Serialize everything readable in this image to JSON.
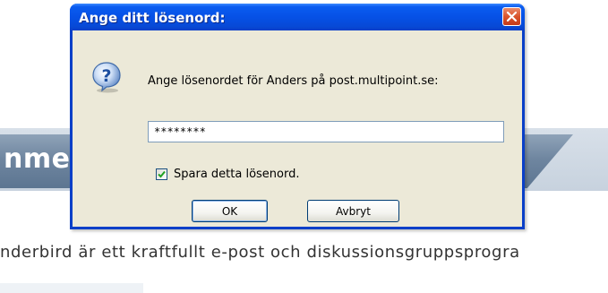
{
  "background": {
    "banner_heading": "nme",
    "paragraph": "nderbird är ett kraftfullt e-post och diskussionsgruppsprogra"
  },
  "dialog": {
    "title": "Ange ditt lösenord:",
    "prompt": "Ange lösenordet för Anders på post.multipoint.se:",
    "password_value": "********",
    "remember_checkbox": {
      "label": "Spara detta lösenord.",
      "checked": true
    },
    "ok_button": "OK",
    "cancel_button": "Avbryt",
    "icons": {
      "close": "close-icon",
      "question": "question-icon",
      "check": "check-icon"
    }
  },
  "colors": {
    "titlebar": "#0651e6",
    "close": "#d9542c",
    "dialog_bg": "#ece9d8",
    "banner": "#6f86a0"
  }
}
